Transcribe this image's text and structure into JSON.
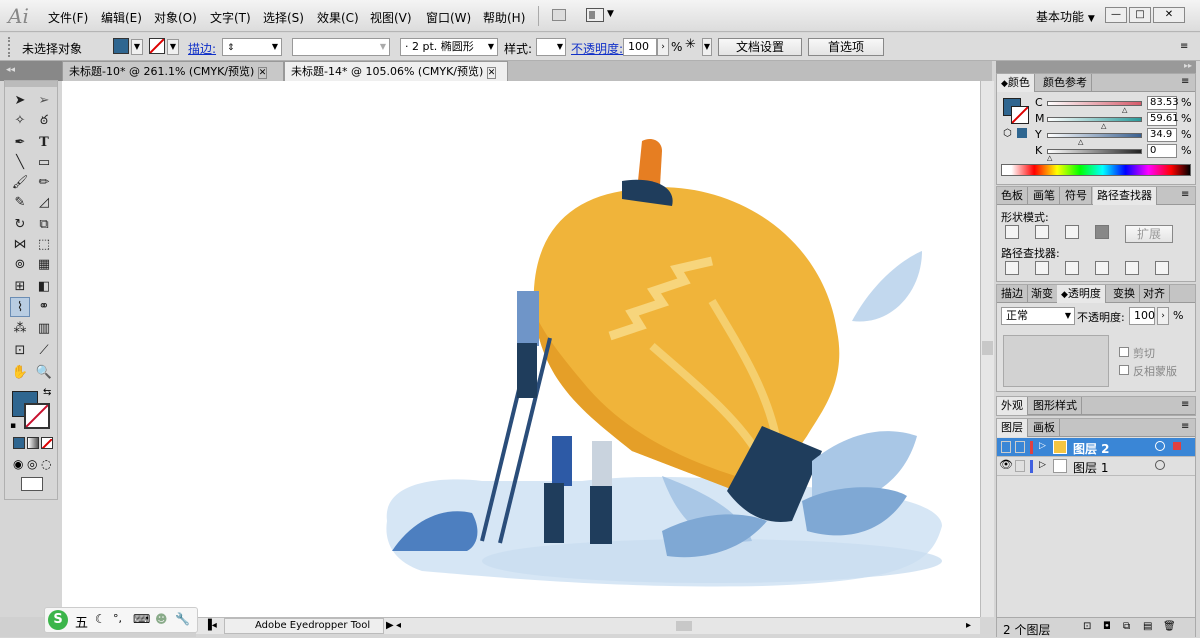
{
  "app": {
    "logo": "Ai"
  },
  "menu": [
    "文件(F)",
    "编辑(E)",
    "对象(O)",
    "文字(T)",
    "选择(S)",
    "效果(C)",
    "视图(V)",
    "窗口(W)",
    "帮助(H)"
  ],
  "workspace": {
    "label": "基本功能",
    "arrow": "▼"
  },
  "window_buttons": {
    "min": "—",
    "max": "□",
    "close": "✕"
  },
  "control_bar": {
    "selection_status": "未选择对象",
    "fill_color": "#2f6690",
    "stroke_label": "描边:",
    "stroke_dot": "·",
    "brush_size": "2 pt. 椭圆形",
    "style_label": "样式:",
    "opacity_label": "不透明度:",
    "opacity_value": "100",
    "percent": "%",
    "doc_settings": "文档设置",
    "preferences": "首选项"
  },
  "tabs": [
    {
      "label": "未标题-10* @ 261.1% (CMYK/预览)",
      "close": "✕"
    },
    {
      "label": "未标题-14* @ 105.06% (CMYK/预览)",
      "close": "✕"
    }
  ],
  "color_panel": {
    "tabs": [
      "颜色",
      "颜色参考"
    ],
    "channels": [
      {
        "name": "C",
        "value": "83.53",
        "pct": 0.835,
        "color": "#d55a6a"
      },
      {
        "name": "M",
        "value": "59.61",
        "pct": 0.596,
        "color": "#2a9a9a"
      },
      {
        "name": "Y",
        "value": "34.9",
        "pct": 0.349,
        "color": "#3a6090"
      },
      {
        "name": "K",
        "value": "0",
        "pct": 0.0,
        "color": "#222222"
      }
    ],
    "pct_sign": "%"
  },
  "pathfinder_panel": {
    "tabs": [
      "色板",
      "画笔",
      "符号",
      "路径查找器"
    ],
    "shape_modes": "形状模式:",
    "expand": "扩展",
    "pathfinders": "路径查找器:"
  },
  "transparency_panel": {
    "tabs": [
      "描边",
      "渐变",
      "透明度",
      "变换",
      "对齐"
    ],
    "blend_mode": "正常",
    "opacity_label": "不透明度:",
    "opacity_value": "100",
    "clip": "剪切",
    "invert_mask": "反相蒙版"
  },
  "appearance_panel": {
    "tabs": [
      "外观",
      "图形样式"
    ]
  },
  "layers_panel": {
    "tabs": [
      "图层",
      "画板"
    ],
    "layers": [
      {
        "name": "图层 2",
        "color": "#e04040",
        "selected": true
      },
      {
        "name": "图层 1",
        "color": "#4060e0",
        "selected": false
      }
    ],
    "count": "2 个图层"
  },
  "status": {
    "tool": "Adobe Eyedropper Tool",
    "arrow": "▶"
  },
  "toolbox": {
    "fill": "#2f6690",
    "stroke": "#c8102e"
  },
  "ime": {
    "mode": "五"
  },
  "colors": {
    "bulb": "#f0b43a",
    "bulb_shade": "#e59f28",
    "base": "#1f3d5c",
    "leaf": "#a9c7e6",
    "cloud": "#d6e6f5",
    "navy": "#2a4d7a"
  }
}
